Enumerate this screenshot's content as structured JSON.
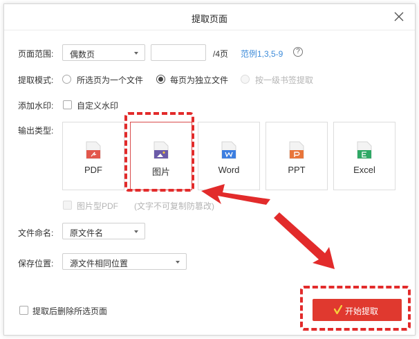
{
  "dialog": {
    "title": "提取页面"
  },
  "page_range": {
    "label": "页面范围:",
    "selected": "偶数页",
    "input_value": "",
    "total": "/4页",
    "example": "范例1,3,5-9",
    "help_glyph": "?"
  },
  "extract_mode": {
    "label": "提取模式:",
    "options": [
      "所选页为一个文件",
      "每页为独立文件",
      "按一级书签提取"
    ],
    "selected_index": 1
  },
  "watermark": {
    "label": "添加水印:",
    "checkbox_label": "自定义水印",
    "checked": false
  },
  "output_type": {
    "label": "输出类型:",
    "cards": [
      {
        "name": "PDF",
        "color": "#e2574c"
      },
      {
        "name": "图片",
        "color": "#6b5ba8"
      },
      {
        "name": "Word",
        "color": "#3c7ee0"
      },
      {
        "name": "PPT",
        "color": "#e8753a"
      },
      {
        "name": "Excel",
        "color": "#2ea865"
      }
    ],
    "selected_index": 1,
    "image_pdf_label": "图片型PDF",
    "image_pdf_note": "(文字不可复制防篡改)"
  },
  "file_naming": {
    "label": "文件命名:",
    "selected": "原文件名"
  },
  "save_location": {
    "label": "保存位置:",
    "selected": "源文件相同位置"
  },
  "delete_after": {
    "label": "提取后删除所选页面",
    "checked": false
  },
  "start_button": {
    "label": "开始提取",
    "color": "#e0392f"
  },
  "annotation_color": "#e22b2b"
}
